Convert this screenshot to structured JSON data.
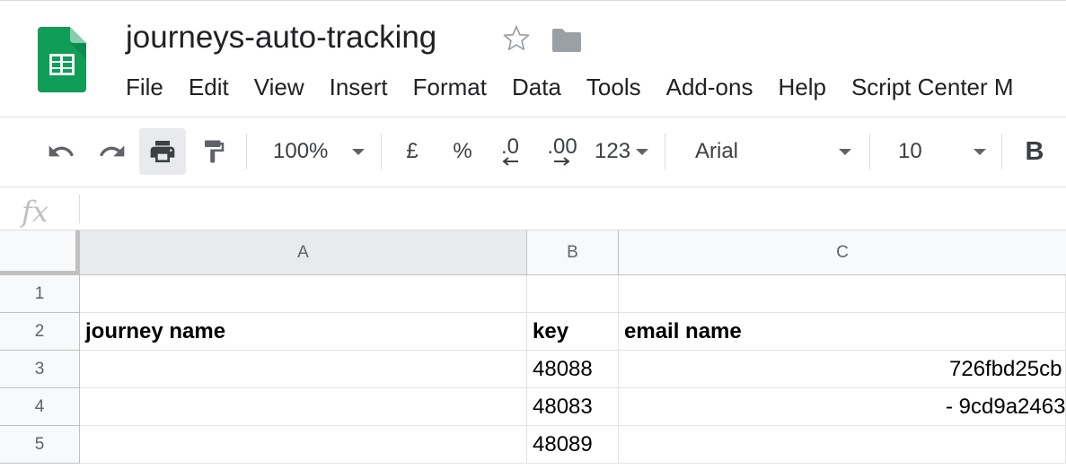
{
  "document": {
    "title": "journeys-auto-tracking"
  },
  "menu": [
    "File",
    "Edit",
    "View",
    "Insert",
    "Format",
    "Data",
    "Tools",
    "Add-ons",
    "Help",
    "Script Center M"
  ],
  "toolbar": {
    "zoom": "100%",
    "currency": "£",
    "percent": "%",
    "decrease_decimals": ".0",
    "increase_decimals": ".00",
    "more_formats": "123",
    "font": "Arial",
    "font_size": "10",
    "bold": "B"
  },
  "formula_bar": {
    "fx_label": "fx",
    "value": ""
  },
  "grid": {
    "columns": [
      "A",
      "B",
      "C"
    ],
    "rows": [
      {
        "num": "1",
        "a": "",
        "b": "",
        "c": ""
      },
      {
        "num": "2",
        "a": "journey name",
        "b": "key",
        "c": "email name"
      },
      {
        "num": "3",
        "a": "",
        "b": "48088",
        "c": "726fbd25cb"
      },
      {
        "num": "4",
        "a": "",
        "b": "48083",
        "c": "- 9cd9a2463"
      },
      {
        "num": "5",
        "a": "",
        "b": "48089",
        "c": ""
      }
    ]
  },
  "colors": {
    "sheets_green": "#0f9d58",
    "header_bg": "#f8f9fa",
    "selected_header_bg": "#e8eaed",
    "gridline": "#e2e3e3"
  }
}
